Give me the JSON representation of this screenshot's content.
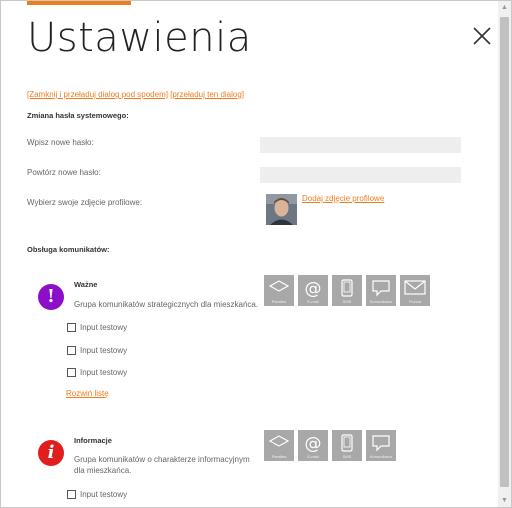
{
  "dialog": {
    "title": "Ustawienia",
    "close_icon": "close-x-icon",
    "accent_color": "#ee7d1e"
  },
  "top_links": {
    "close_and_reload_under": "[Zamknij i przeładuj dialog pod spodem]",
    "reload_this": "[przeładuj ten dialog]"
  },
  "password_section": {
    "title": "Zmiana hasła systemowego:",
    "new_password_label": "Wpisz nowe hasło:",
    "new_password_value": "",
    "repeat_password_label": "Powtórz nowe hasło:",
    "repeat_password_value": "",
    "photo_label": "Wybierz swoje zdjęcie profilowe:",
    "add_photo_link": "Dodaj zdjęcie profilowe"
  },
  "messages_section": {
    "title": "Obsługa komunikatów:",
    "groups": [
      {
        "name": "Ważne",
        "icon": "exclamation-icon",
        "icon_color": "#8b0fc7",
        "description": "Grupa komunikatów strategicznych dla mieszkańca.",
        "items": [
          "Input testowy",
          "Input testowy",
          "Input testowy"
        ],
        "expand_link": "Rozwiń listę",
        "channels": [
          {
            "label": "Pamiłeo",
            "icon": "diamond-icon"
          },
          {
            "label": "E-mail",
            "icon": "at-icon"
          },
          {
            "label": "SMS",
            "icon": "phone-icon"
          },
          {
            "label": "Komunikator",
            "icon": "speech-bubble-icon"
          },
          {
            "label": "Poczta",
            "icon": "envelope-icon"
          }
        ]
      },
      {
        "name": "Informacje",
        "icon": "info-icon",
        "icon_color": "#e01e1e",
        "description_line1": "Grupa komunikatów o charakterze informacyjnym",
        "description_line2": "dla mieszkańca.",
        "items": [
          "Input testowy"
        ],
        "channels": [
          {
            "label": "Pamiłeo",
            "icon": "diamond-icon"
          },
          {
            "label": "E-mail",
            "icon": "at-icon"
          },
          {
            "label": "SMS",
            "icon": "phone-icon"
          },
          {
            "label": "Komunikator",
            "icon": "speech-bubble-icon"
          }
        ]
      }
    ]
  }
}
